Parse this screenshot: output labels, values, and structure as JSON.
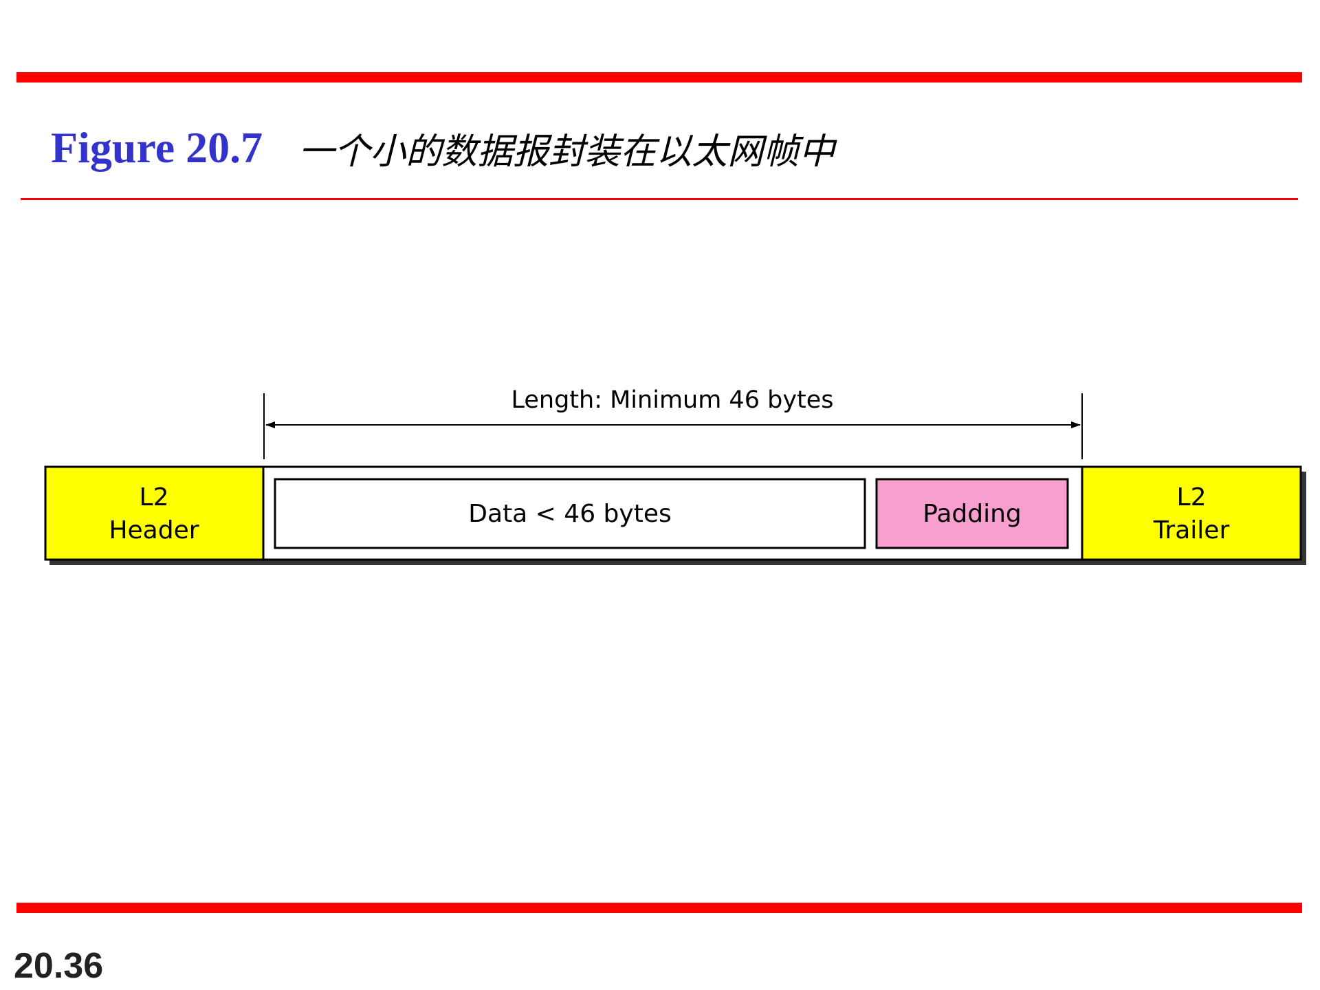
{
  "slide": {
    "figure_label": "Figure 20.7",
    "caption": "一个小的数据报封装在以太网帧中",
    "page_number": "20.36",
    "colors": {
      "rules": "#ff0000",
      "figure_label": "#3333cc",
      "header_trailer_fill": "#ffff00",
      "padding_fill": "#f79fcf",
      "data_fill": "#ffffff"
    }
  },
  "diagram": {
    "length_label": "Length: Minimum 46 bytes",
    "header_line1": "L2",
    "header_line2": "Header",
    "data_label": "Data < 46 bytes",
    "padding_label": "Padding",
    "trailer_line1": "L2",
    "trailer_line2": "Trailer"
  }
}
